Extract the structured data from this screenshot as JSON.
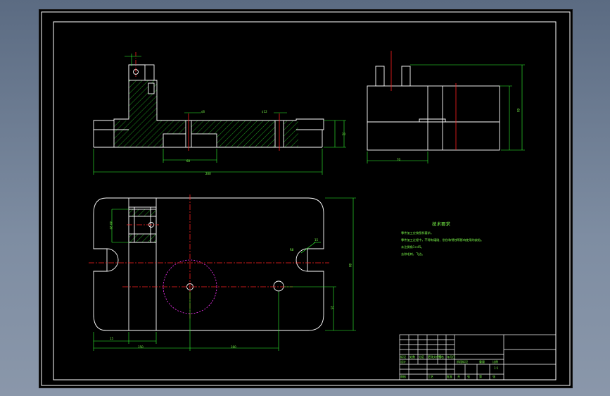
{
  "colors": {
    "background": "#000000",
    "outline": "#ffffff",
    "dimension": "#33ff33",
    "center_line": "#ff2020",
    "hidden_circle": "#ff33ff",
    "hatch": "#33ff33"
  },
  "dimensions": {
    "front_width": "200",
    "front_slot_width": "60",
    "front_pin_right": "¢12",
    "front_pin_left": "¢6",
    "front_height_right": "20",
    "side_width": "70",
    "side_height": "60",
    "top_dim_left_1": "15",
    "top_dim_left_2": "150",
    "top_dim_center": "160",
    "top_height": "80",
    "top_right_radius": "R8",
    "top_right_small": "15",
    "top_lower_right": "35",
    "top_left_vertical": "40 20"
  },
  "notes": {
    "title": "技术要求",
    "lines": [
      "零件加工应按图样要求。",
      "零件加工过程中，不得有磕碰、划伤和锈蚀等影响使用的缺陷。",
      "未注倒角1×45。",
      "去除毛刺，飞边。"
    ]
  },
  "title_block": {
    "labels": [
      "标记",
      "处数",
      "分区",
      "更改文件号",
      "签名",
      "年月日",
      "设计",
      "审核",
      "工艺",
      "批准",
      "阶段标记",
      "重量",
      "比例",
      "共",
      "张",
      "第",
      "张"
    ],
    "scale_value": "1:1"
  }
}
